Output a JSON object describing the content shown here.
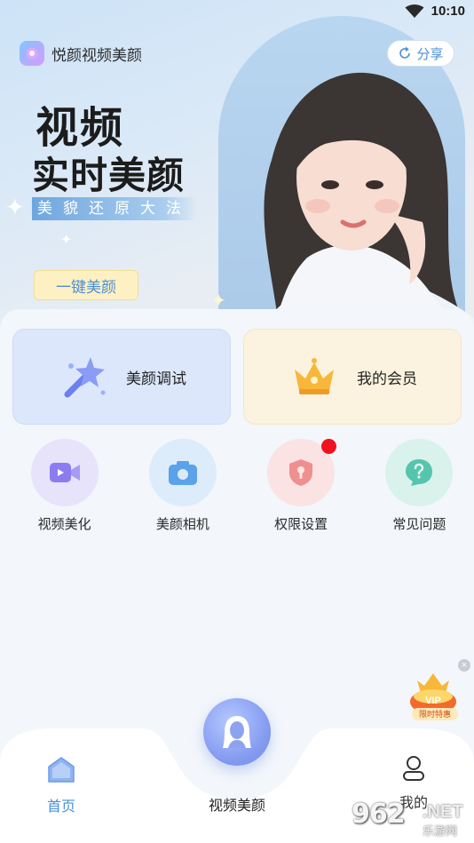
{
  "status_bar": {
    "time": "10:10",
    "icons": [
      "wifi-icon",
      "signal-icon"
    ]
  },
  "header": {
    "app_name": "悦颜视频美颜",
    "share_label": "分享"
  },
  "hero": {
    "headline_line1": "视频",
    "headline_line2": "实时美颜",
    "tagline": "美貌还原大法",
    "cta_label": "一键美颜"
  },
  "feature_cards": [
    {
      "label": "美颜调试",
      "icon": "magic-wand-icon"
    },
    {
      "label": "我的会员",
      "icon": "crown-icon"
    }
  ],
  "grid_items": [
    {
      "label": "视频美化",
      "icon": "video-camera-icon",
      "color": "#8c7cf0"
    },
    {
      "label": "美颜相机",
      "icon": "camera-icon",
      "color": "#5aa2ea"
    },
    {
      "label": "权限设置",
      "icon": "shield-icon",
      "color": "#ef8f90",
      "badge": true
    },
    {
      "label": "常见问题",
      "icon": "question-icon",
      "color": "#55c5ad"
    }
  ],
  "vip_promo": {
    "badge_text": "VIP",
    "tag_text": "限时特惠"
  },
  "bottom_nav": {
    "home_label": "首页",
    "center_label": "视频美颜",
    "mine_label": "我的"
  },
  "watermark": {
    "number": "962",
    "suffix": ".NET",
    "sub": "乐游网"
  },
  "colors": {
    "accent": "#4a8fd6",
    "badge_red": "#f0131e"
  }
}
